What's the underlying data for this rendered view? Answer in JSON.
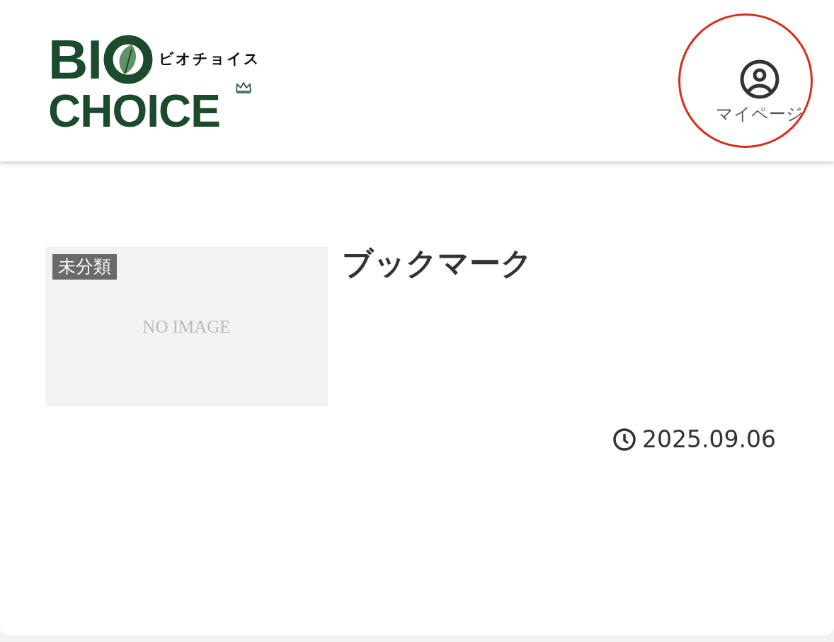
{
  "header": {
    "logo": {
      "word_top": "BI",
      "word_bottom": "CHOICE",
      "kana": "ビオチョイス"
    },
    "mypage": {
      "label": "マイページ"
    }
  },
  "posts": [
    {
      "category": "未分類",
      "image_text": "NO IMAGE",
      "title": "ブックマーク",
      "date": "2025.09.06"
    }
  ]
}
